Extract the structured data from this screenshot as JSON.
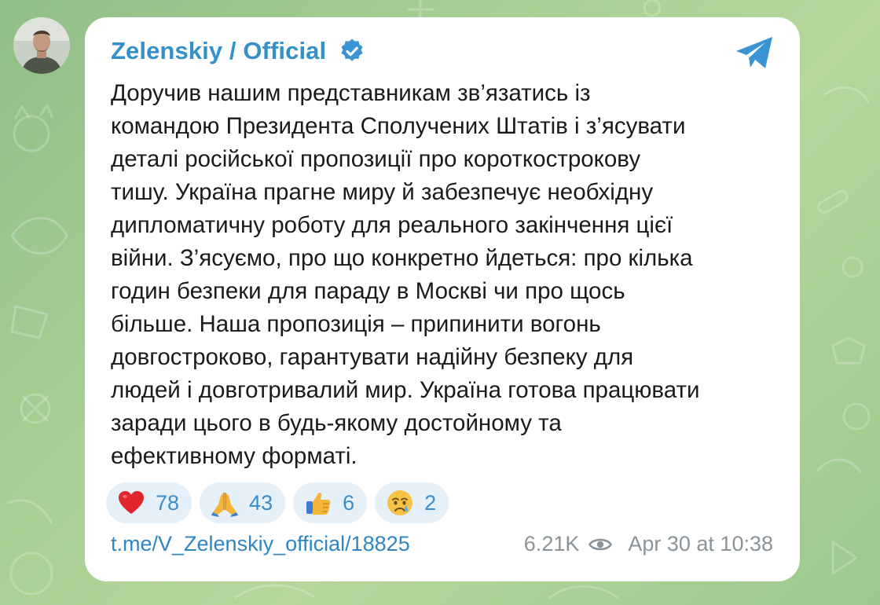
{
  "channel": {
    "name": "Zelenskiy / Official",
    "verified": true,
    "avatar_icon": "profile-photo"
  },
  "post": {
    "text": "Доручив нашим представникам зв’язатись із\nкомандою Президента Сполучених Штатів і з’ясувати\nдеталі російської пропозиції про короткострокову\nтишу. Україна прагне миру й забезпечує необхідну\nдипломатичну роботу для реального закінчення цієї\nвійни. З’ясуємо, про що конкретно йдеться: про кілька\nгодин безпеки для параду в Москві чи про щось\nбільше. Наша пропозиція – припинити вогонь\nдовгостроково, гарантувати надійну безпеку для\nлюдей і довготривалий мир. Україна готова працювати\nзаради цього в будь-якому достойному та\nефективному форматі.",
    "reactions": [
      {
        "emoji": "red-heart",
        "count": "78"
      },
      {
        "emoji": "folded-hands",
        "count": "43"
      },
      {
        "emoji": "thumbs-up",
        "count": "6"
      },
      {
        "emoji": "crying-face",
        "count": "2"
      }
    ],
    "link": "t.me/V_Zelenskiy_official/18825",
    "views": "6.21K",
    "timestamp": "Apr 30 at 10:38"
  },
  "colors": {
    "accent": "#3390c8",
    "link": "#2f86c2",
    "reaction_bg": "#e6f0f8",
    "meta_text": "#8a9399",
    "wallpaper": "#a9cf94"
  }
}
